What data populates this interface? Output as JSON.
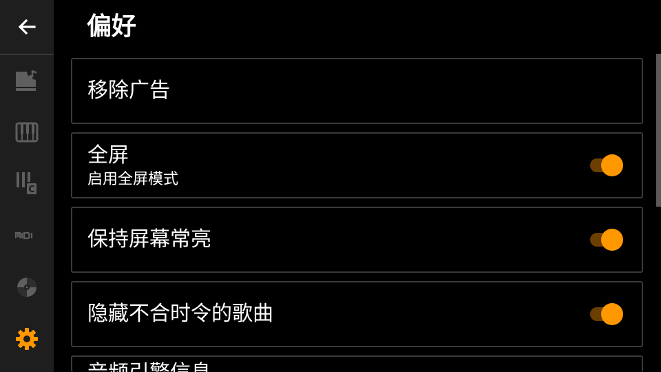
{
  "header": {
    "title": "偏好"
  },
  "sidebar": {
    "back_icon": "arrow-left-icon",
    "items": [
      {
        "icon": "grand-piano-music-icon",
        "active": false
      },
      {
        "icon": "piano-keyboard-icon",
        "active": false
      },
      {
        "icon": "chord-c-icon",
        "active": false
      },
      {
        "icon": "midi-icon",
        "active": false
      },
      {
        "icon": "vinyl-disc-icon",
        "active": false
      },
      {
        "icon": "gear-icon",
        "active": true
      }
    ]
  },
  "settings": {
    "remove_ads": {
      "title": "移除广告"
    },
    "fullscreen": {
      "title": "全屏",
      "subtitle": "启用全屏模式",
      "enabled": true
    },
    "keep_screen_on": {
      "title": "保持屏幕常亮",
      "enabled": true
    },
    "hide_out_of_season": {
      "title": "隐藏不合时令的歌曲",
      "enabled": true
    },
    "audio_engine_info": {
      "title": "音频引擎信息"
    }
  },
  "colors": {
    "accent": "#ff9800",
    "accent_dim": "#6b3f00",
    "sidebar_bg": "#1e1e1e",
    "icon_inactive": "#5f5f5f",
    "card_border": "#3a3a3a"
  }
}
